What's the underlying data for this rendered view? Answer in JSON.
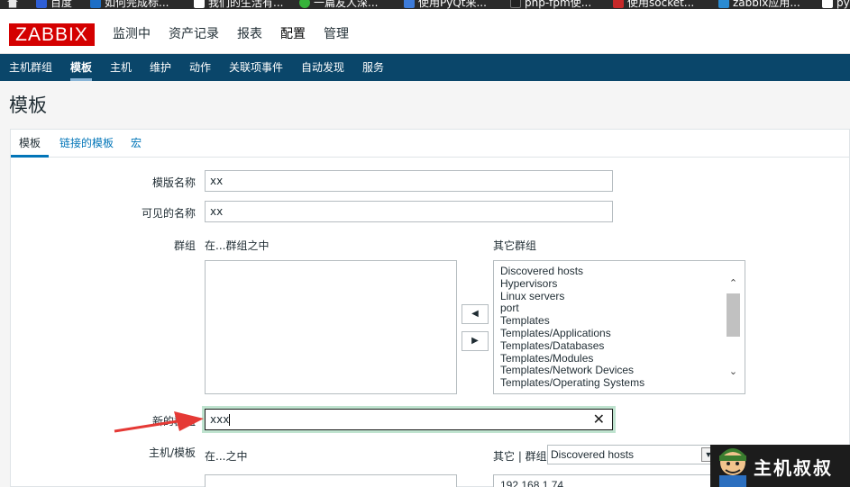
{
  "browser": {
    "bookmarks": [
      {
        "label": "百度",
        "color": "#2f5fd6"
      },
      {
        "label": "如何完成标...",
        "color": "#1d6ec5"
      },
      {
        "label": "我们的生活有...",
        "color": "#ffffff"
      },
      {
        "label": "一篇友人深...",
        "color": "#36b33a"
      },
      {
        "label": "使用PyQt来...",
        "color": "#3d7bd9"
      },
      {
        "label": "php-fpm使...",
        "color": "#222222"
      },
      {
        "label": "使用socket...",
        "color": "#c62828"
      },
      {
        "label": "zabbix应用...",
        "color": "#2a8bd2"
      },
      {
        "label": "py",
        "color": "#ffffff"
      }
    ]
  },
  "header": {
    "logo": "ZABBIX",
    "menu": [
      "监测中",
      "资产记录",
      "报表",
      "配置",
      "管理"
    ],
    "active_menu": "配置"
  },
  "subnav": {
    "items": [
      "主机群组",
      "模板",
      "主机",
      "维护",
      "动作",
      "关联项事件",
      "自动发现",
      "服务"
    ],
    "active": "模板"
  },
  "page": {
    "title": "模板",
    "tabs": [
      "模板",
      "链接的模板",
      "宏"
    ],
    "active_tab": "模板"
  },
  "form": {
    "template_name_label": "模版名称",
    "template_name_value": "xx",
    "visible_name_label": "可见的名称",
    "visible_name_value": "xx",
    "groups_label": "群组",
    "in_groups_label": "在...群组之中",
    "other_groups_label": "其它群组",
    "in_groups": [],
    "other_groups": [
      "Discovered hosts",
      "Hypervisors",
      "Linux servers",
      "port",
      "Templates",
      "Templates/Applications",
      "Templates/Databases",
      "Templates/Modules",
      "Templates/Network Devices",
      "Templates/Operating Systems"
    ],
    "move_left": "◀",
    "move_right": "▶",
    "new_group_label": "新的群组",
    "new_group_value": "xxx",
    "clear_icon": "✕",
    "hosts_label": "主机/模板",
    "in_label": "在...之中",
    "other_group_label": "其它 | 群组",
    "other_group_select": "Discovered hosts",
    "hosts_list": [
      "192.168.1.74"
    ]
  },
  "watermark": {
    "text": "主机叔叔"
  },
  "colors": {
    "brand_red": "#d40000",
    "subnav_blue": "#0a466a",
    "link_blue": "#0275b8",
    "focus_green": "#bfe3cf",
    "annotation_red": "#e53935"
  }
}
